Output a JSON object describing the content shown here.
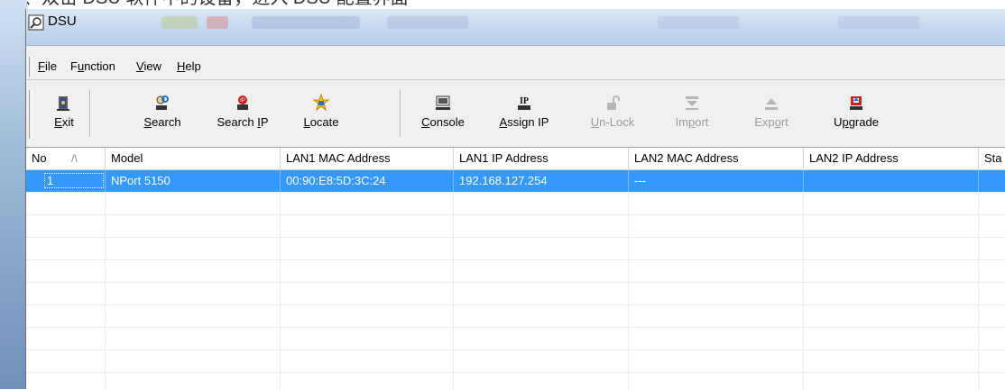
{
  "caption": "二、双击 DSU 软件中的设备，进入 DSU 配置界面",
  "window": {
    "title": "DSU"
  },
  "menu": {
    "items": [
      {
        "label": "File",
        "accel": "F"
      },
      {
        "label": "Function",
        "accel": "u"
      },
      {
        "label": "View",
        "accel": "V"
      },
      {
        "label": "Help",
        "accel": "H"
      }
    ]
  },
  "toolbar": {
    "buttons": [
      {
        "label": "Exit",
        "icon": "exit-icon",
        "enabled": true
      },
      {
        "label": "Search",
        "icon": "search-icon",
        "enabled": true
      },
      {
        "label": "Search IP",
        "icon": "search-ip-icon",
        "enabled": true
      },
      {
        "label": "Locate",
        "icon": "locate-icon",
        "enabled": true
      },
      {
        "label": "Console",
        "icon": "console-icon",
        "enabled": true
      },
      {
        "label": "Assign IP",
        "icon": "assign-ip-icon",
        "enabled": true
      },
      {
        "label": "Un-Lock",
        "icon": "unlock-icon",
        "enabled": false
      },
      {
        "label": "Import",
        "icon": "import-icon",
        "enabled": false
      },
      {
        "label": "Export",
        "icon": "export-icon",
        "enabled": false
      },
      {
        "label": "Upgrade",
        "icon": "upgrade-icon",
        "enabled": true
      }
    ]
  },
  "table": {
    "sort_indicator": "/\\",
    "columns": [
      "No",
      "Model",
      "LAN1 MAC Address",
      "LAN1 IP Address",
      "LAN2 MAC Address",
      "LAN2 IP Address",
      "Sta"
    ],
    "rows": [
      {
        "no": "1",
        "model": "NPort 5150",
        "lan1_mac": "00:90:E8:5D:3C:24",
        "lan1_ip": "192.168.127.254",
        "lan2_mac": "---",
        "lan2_ip": "",
        "status": "",
        "selected": true
      }
    ]
  },
  "colors": {
    "selection": "#3399ff",
    "titlebar": "#c6d9ef"
  }
}
